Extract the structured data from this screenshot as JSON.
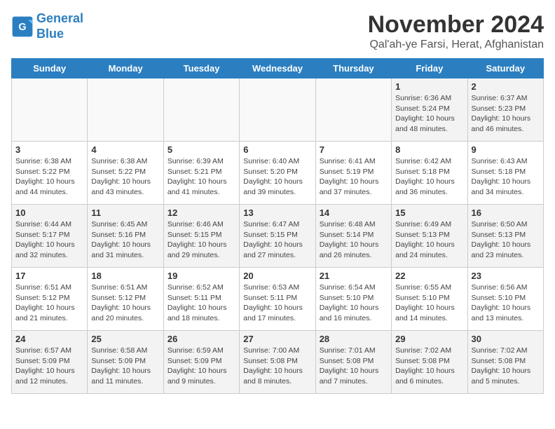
{
  "header": {
    "logo_line1": "General",
    "logo_line2": "Blue",
    "month": "November 2024",
    "location": "Qal'ah-ye Farsi, Herat, Afghanistan"
  },
  "days_of_week": [
    "Sunday",
    "Monday",
    "Tuesday",
    "Wednesday",
    "Thursday",
    "Friday",
    "Saturday"
  ],
  "weeks": [
    [
      {
        "day": "",
        "info": ""
      },
      {
        "day": "",
        "info": ""
      },
      {
        "day": "",
        "info": ""
      },
      {
        "day": "",
        "info": ""
      },
      {
        "day": "",
        "info": ""
      },
      {
        "day": "1",
        "info": "Sunrise: 6:36 AM\nSunset: 5:24 PM\nDaylight: 10 hours\nand 48 minutes."
      },
      {
        "day": "2",
        "info": "Sunrise: 6:37 AM\nSunset: 5:23 PM\nDaylight: 10 hours\nand 46 minutes."
      }
    ],
    [
      {
        "day": "3",
        "info": "Sunrise: 6:38 AM\nSunset: 5:22 PM\nDaylight: 10 hours\nand 44 minutes."
      },
      {
        "day": "4",
        "info": "Sunrise: 6:38 AM\nSunset: 5:22 PM\nDaylight: 10 hours\nand 43 minutes."
      },
      {
        "day": "5",
        "info": "Sunrise: 6:39 AM\nSunset: 5:21 PM\nDaylight: 10 hours\nand 41 minutes."
      },
      {
        "day": "6",
        "info": "Sunrise: 6:40 AM\nSunset: 5:20 PM\nDaylight: 10 hours\nand 39 minutes."
      },
      {
        "day": "7",
        "info": "Sunrise: 6:41 AM\nSunset: 5:19 PM\nDaylight: 10 hours\nand 37 minutes."
      },
      {
        "day": "8",
        "info": "Sunrise: 6:42 AM\nSunset: 5:18 PM\nDaylight: 10 hours\nand 36 minutes."
      },
      {
        "day": "9",
        "info": "Sunrise: 6:43 AM\nSunset: 5:18 PM\nDaylight: 10 hours\nand 34 minutes."
      }
    ],
    [
      {
        "day": "10",
        "info": "Sunrise: 6:44 AM\nSunset: 5:17 PM\nDaylight: 10 hours\nand 32 minutes."
      },
      {
        "day": "11",
        "info": "Sunrise: 6:45 AM\nSunset: 5:16 PM\nDaylight: 10 hours\nand 31 minutes."
      },
      {
        "day": "12",
        "info": "Sunrise: 6:46 AM\nSunset: 5:15 PM\nDaylight: 10 hours\nand 29 minutes."
      },
      {
        "day": "13",
        "info": "Sunrise: 6:47 AM\nSunset: 5:15 PM\nDaylight: 10 hours\nand 27 minutes."
      },
      {
        "day": "14",
        "info": "Sunrise: 6:48 AM\nSunset: 5:14 PM\nDaylight: 10 hours\nand 26 minutes."
      },
      {
        "day": "15",
        "info": "Sunrise: 6:49 AM\nSunset: 5:13 PM\nDaylight: 10 hours\nand 24 minutes."
      },
      {
        "day": "16",
        "info": "Sunrise: 6:50 AM\nSunset: 5:13 PM\nDaylight: 10 hours\nand 23 minutes."
      }
    ],
    [
      {
        "day": "17",
        "info": "Sunrise: 6:51 AM\nSunset: 5:12 PM\nDaylight: 10 hours\nand 21 minutes."
      },
      {
        "day": "18",
        "info": "Sunrise: 6:51 AM\nSunset: 5:12 PM\nDaylight: 10 hours\nand 20 minutes."
      },
      {
        "day": "19",
        "info": "Sunrise: 6:52 AM\nSunset: 5:11 PM\nDaylight: 10 hours\nand 18 minutes."
      },
      {
        "day": "20",
        "info": "Sunrise: 6:53 AM\nSunset: 5:11 PM\nDaylight: 10 hours\nand 17 minutes."
      },
      {
        "day": "21",
        "info": "Sunrise: 6:54 AM\nSunset: 5:10 PM\nDaylight: 10 hours\nand 16 minutes."
      },
      {
        "day": "22",
        "info": "Sunrise: 6:55 AM\nSunset: 5:10 PM\nDaylight: 10 hours\nand 14 minutes."
      },
      {
        "day": "23",
        "info": "Sunrise: 6:56 AM\nSunset: 5:10 PM\nDaylight: 10 hours\nand 13 minutes."
      }
    ],
    [
      {
        "day": "24",
        "info": "Sunrise: 6:57 AM\nSunset: 5:09 PM\nDaylight: 10 hours\nand 12 minutes."
      },
      {
        "day": "25",
        "info": "Sunrise: 6:58 AM\nSunset: 5:09 PM\nDaylight: 10 hours\nand 11 minutes."
      },
      {
        "day": "26",
        "info": "Sunrise: 6:59 AM\nSunset: 5:09 PM\nDaylight: 10 hours\nand 9 minutes."
      },
      {
        "day": "27",
        "info": "Sunrise: 7:00 AM\nSunset: 5:08 PM\nDaylight: 10 hours\nand 8 minutes."
      },
      {
        "day": "28",
        "info": "Sunrise: 7:01 AM\nSunset: 5:08 PM\nDaylight: 10 hours\nand 7 minutes."
      },
      {
        "day": "29",
        "info": "Sunrise: 7:02 AM\nSunset: 5:08 PM\nDaylight: 10 hours\nand 6 minutes."
      },
      {
        "day": "30",
        "info": "Sunrise: 7:02 AM\nSunset: 5:08 PM\nDaylight: 10 hours\nand 5 minutes."
      }
    ]
  ]
}
